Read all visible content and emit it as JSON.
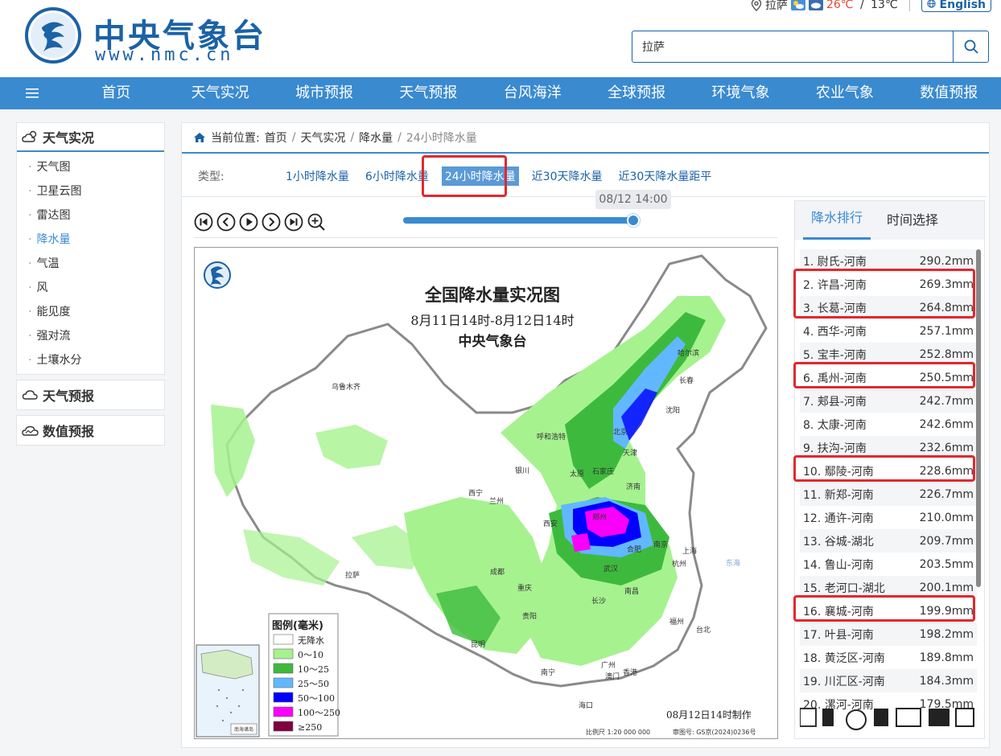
{
  "header": {
    "site_name": "中央气象台",
    "site_url": "www.nmc.cn",
    "location": "拉萨",
    "temp_high": "26℃",
    "temp_separator": " / ",
    "temp_low": "13℃",
    "english_label": "English"
  },
  "search": {
    "value": "拉萨"
  },
  "nav": {
    "menu_icon": "hamburger-icon",
    "items": [
      "首页",
      "天气实况",
      "城市预报",
      "天气预报",
      "台风海洋",
      "全球预报",
      "环境气象",
      "农业气象",
      "数值预报"
    ]
  },
  "sidebar": {
    "sections": [
      {
        "title": "天气实况",
        "icon": "cloud-sun-icon"
      },
      {
        "title": "天气预报",
        "icon": "cloud-icon"
      },
      {
        "title": "数值预报",
        "icon": "chart-cloud-icon"
      }
    ],
    "items": [
      "天气图",
      "卫星云图",
      "雷达图",
      "降水量",
      "气温",
      "风",
      "能见度",
      "强对流",
      "土壤水分"
    ],
    "selected_index": 3
  },
  "breadcrumb": {
    "prefix": "当前位置:",
    "items": [
      "首页",
      "天气实况",
      "降水量",
      "24小时降水量"
    ]
  },
  "type_row": {
    "label": "类型:",
    "tabs": [
      "1小时降水量",
      "6小时降水量",
      "24小时降水量",
      "近30天降水量",
      "近30天降水量距平"
    ],
    "active_index": 2
  },
  "player": {
    "time_tooltip": "08/12 14:00",
    "progress": 1.0,
    "buttons": [
      "first-icon",
      "prev-icon",
      "play-icon",
      "next-icon",
      "last-icon",
      "zoom-in-icon"
    ]
  },
  "map": {
    "title": "全国降水量实况图",
    "period": "8月11日14时-8月12日14时",
    "issuer": "中央气象台",
    "legend_title": "图例(毫米)",
    "legend": [
      {
        "label": "无降水",
        "color": "#ffffff"
      },
      {
        "label": "0～10",
        "color": "#a6f28f"
      },
      {
        "label": "10～25",
        "color": "#3dba3d"
      },
      {
        "label": "25～50",
        "color": "#61b8ff"
      },
      {
        "label": "50～100",
        "color": "#0000ff"
      },
      {
        "label": "100～250",
        "color": "#fa00fa"
      },
      {
        "label": "≥250",
        "color": "#800040"
      }
    ],
    "made_at": "08月12日14时制作",
    "scale": "比例尺 1:20 000 000",
    "map_number": "审图号: GS京(2024)0236号",
    "cities": [
      "乌鲁木齐",
      "哈尔滨",
      "长春",
      "沈阳",
      "呼和浩特",
      "北京",
      "天津",
      "银川",
      "太原",
      "石家庄",
      "西宁",
      "兰州",
      "济南",
      "郑州",
      "西安",
      "合肥",
      "南京",
      "上海",
      "拉萨",
      "成都",
      "武汉",
      "杭州",
      "重庆",
      "长沙",
      "南昌",
      "贵阳",
      "福州",
      "台北",
      "昆明",
      "南宁",
      "广州",
      "澳门",
      "香港",
      "海口"
    ],
    "inset_label": "南海诸岛"
  },
  "ranking": {
    "tabs": [
      "降水排行",
      "时间选择"
    ],
    "active_tab": 0,
    "rows": [
      {
        "name": "1. 尉氏-河南",
        "value": "290.2mm"
      },
      {
        "name": "2. 许昌-河南",
        "value": "269.3mm"
      },
      {
        "name": "3. 长葛-河南",
        "value": "264.8mm"
      },
      {
        "name": "4. 西华-河南",
        "value": "257.1mm"
      },
      {
        "name": "5. 宝丰-河南",
        "value": "252.8mm"
      },
      {
        "name": "6. 禹州-河南",
        "value": "250.5mm"
      },
      {
        "name": "7. 郏县-河南",
        "value": "242.7mm"
      },
      {
        "name": "8. 太康-河南",
        "value": "242.6mm"
      },
      {
        "name": "9. 扶沟-河南",
        "value": "232.6mm"
      },
      {
        "name": "10. 鄢陵-河南",
        "value": "228.6mm"
      },
      {
        "name": "11. 新郑-河南",
        "value": "226.7mm"
      },
      {
        "name": "12. 通许-河南",
        "value": "210.0mm"
      },
      {
        "name": "13. 谷城-湖北",
        "value": "209.7mm"
      },
      {
        "name": "14. 鲁山-河南",
        "value": "203.5mm"
      },
      {
        "name": "15. 老河口-湖北",
        "value": "200.1mm"
      },
      {
        "name": "16. 襄城-河南",
        "value": "199.9mm"
      },
      {
        "name": "17. 叶县-河南",
        "value": "198.2mm"
      },
      {
        "name": "18. 黄泛区-河南",
        "value": "189.8mm"
      },
      {
        "name": "19. 川汇区-河南",
        "value": "184.3mm"
      },
      {
        "name": "20. 漯河-河南",
        "value": "179.5mm"
      }
    ],
    "highlighted": [
      1,
      2,
      5,
      9,
      15
    ]
  },
  "colors": {
    "brand": "#1b62a6",
    "nav": "#3a8ad0",
    "highlight": "#e0282e"
  }
}
